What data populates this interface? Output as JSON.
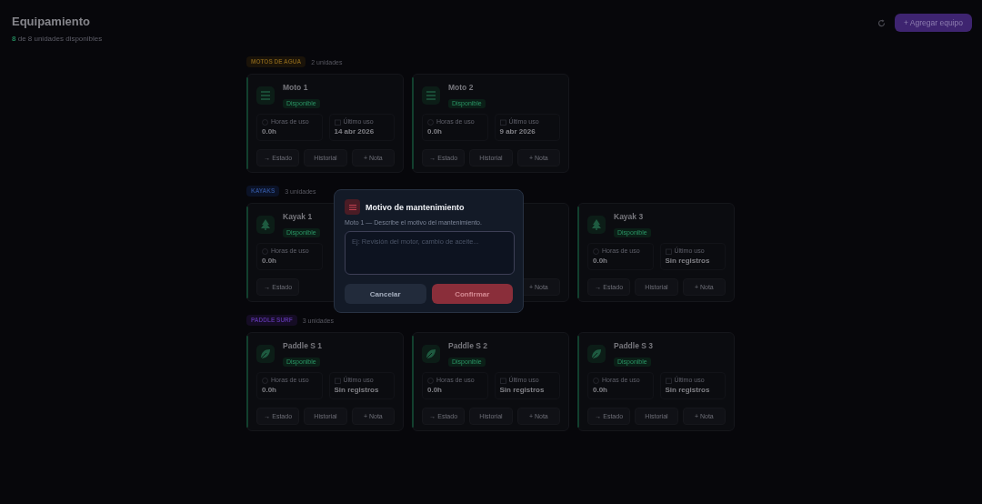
{
  "header": {
    "title": "Equipamiento",
    "available_count": "8",
    "available_text": "de 8 unidades disponibles",
    "add_button": "+ Agregar equipo"
  },
  "sections": [
    {
      "tag": "MOTOS DE AGUA",
      "kind": "moto",
      "count": "2 unidades",
      "cards": [
        {
          "name": "Moto 1",
          "status": "Disponible",
          "stats": [
            {
              "kind": "hours",
              "label": "Horas de uso",
              "value": "0.0h"
            },
            {
              "kind": "last_use",
              "label": "Último uso",
              "value": "14 abr 2026"
            }
          ],
          "buttons": [
            {
              "kind": "status",
              "label": "→ Estado"
            },
            {
              "kind": "history",
              "label": "Historial"
            },
            {
              "kind": "note",
              "label": "+ Nota"
            }
          ]
        },
        {
          "name": "Moto 2",
          "status": "Disponible",
          "stats": [
            {
              "kind": "hours",
              "label": "Horas de uso",
              "value": "0.0h"
            },
            {
              "kind": "last_use",
              "label": "Último uso",
              "value": "9 abr 2026"
            }
          ],
          "buttons": [
            {
              "kind": "status",
              "label": "→ Estado"
            },
            {
              "kind": "history",
              "label": "Historial"
            },
            {
              "kind": "note",
              "label": "+ Nota"
            }
          ]
        }
      ]
    },
    {
      "tag": "KAYAKS",
      "kind": "kayak",
      "count": "3 unidades",
      "cards": [
        {
          "name": "Kayak 1",
          "status": "Disponible",
          "stats": [
            {
              "kind": "hours",
              "label": "Horas de uso",
              "value": "0.0h"
            }
          ],
          "buttons": [
            {
              "kind": "status",
              "label": "→ Estado"
            }
          ]
        },
        {
          "buttons": [
            {
              "kind": "note",
              "label": "+ Nota"
            }
          ]
        },
        {
          "name": "Kayak 3",
          "status": "Disponible",
          "stats": [
            {
              "kind": "hours",
              "label": "Horas de uso",
              "value": "0.0h"
            },
            {
              "kind": "last_use",
              "label": "Último uso",
              "value": "Sin registros"
            }
          ],
          "buttons": [
            {
              "kind": "status",
              "label": "→ Estado"
            },
            {
              "kind": "history",
              "label": "Historial"
            },
            {
              "kind": "note",
              "label": "+ Nota"
            }
          ]
        }
      ]
    },
    {
      "tag": "PADDLE SURF",
      "kind": "paddle",
      "count": "3 unidades",
      "cards": [
        {
          "name": "Paddle S 1",
          "status": "Disponible",
          "stats": [
            {
              "kind": "hours",
              "label": "Horas de uso",
              "value": "0.0h"
            },
            {
              "kind": "last_use",
              "label": "Último uso",
              "value": "Sin registros"
            }
          ],
          "buttons": [
            {
              "kind": "status",
              "label": "→ Estado"
            },
            {
              "kind": "history",
              "label": "Historial"
            },
            {
              "kind": "note",
              "label": "+ Nota"
            }
          ]
        },
        {
          "name": "Paddle S 2",
          "status": "Disponible",
          "stats": [
            {
              "kind": "hours",
              "label": "Horas de uso",
              "value": "0.0h"
            },
            {
              "kind": "last_use",
              "label": "Último uso",
              "value": "Sin registros"
            }
          ],
          "buttons": [
            {
              "kind": "status",
              "label": "→ Estado"
            },
            {
              "kind": "history",
              "label": "Historial"
            },
            {
              "kind": "note",
              "label": "+ Nota"
            }
          ]
        },
        {
          "name": "Paddle S 3",
          "status": "Disponible",
          "stats": [
            {
              "kind": "hours",
              "label": "Horas de uso",
              "value": "0.0h"
            },
            {
              "kind": "last_use",
              "label": "Último uso",
              "value": "Sin registros"
            }
          ],
          "buttons": [
            {
              "kind": "status",
              "label": "→ Estado"
            },
            {
              "kind": "history",
              "label": "Historial"
            },
            {
              "kind": "note",
              "label": "+ Nota"
            }
          ]
        }
      ]
    }
  ],
  "modal": {
    "title": "Motivo de mantenimiento",
    "subtitle": "Moto 1 — Describe el motivo del mantenimiento.",
    "placeholder": "Ej: Revisión del motor, cambio de aceite...",
    "buttons": [
      {
        "kind": "cancel",
        "label": "Cancelar"
      },
      {
        "kind": "confirm",
        "label": "Confirmar"
      }
    ]
  }
}
